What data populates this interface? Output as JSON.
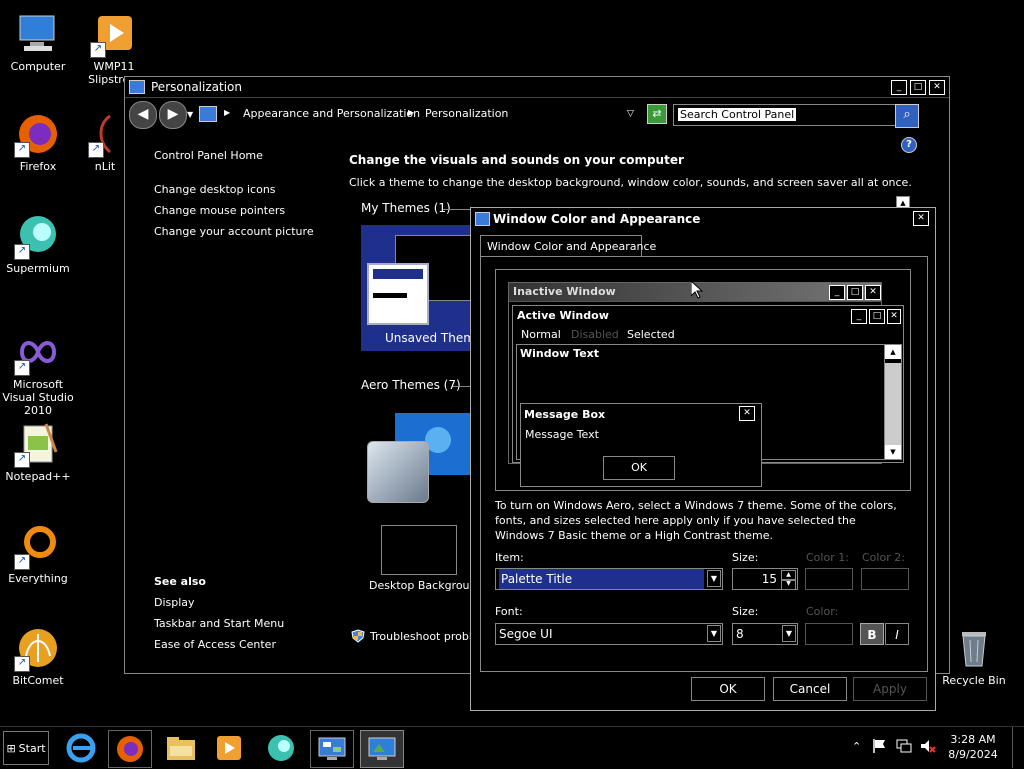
{
  "desktop": {
    "icons": [
      {
        "label": "Computer"
      },
      {
        "label": "WMP11 Slipstre..."
      },
      {
        "label": "Firefox"
      },
      {
        "label": "nLit"
      },
      {
        "label": "Supermium"
      },
      {
        "label": "Microsoft Visual Studio 2010"
      },
      {
        "label": "Notepad++"
      },
      {
        "label": "Everything"
      },
      {
        "label": "BitComet"
      },
      {
        "label": "Recycle Bin"
      }
    ]
  },
  "personalization": {
    "title": "Personalization",
    "breadcrumb": [
      "Appearance and Personalization",
      "Personalization"
    ],
    "search_placeholder": "Search Control Panel",
    "sidebar": {
      "home": "Control Panel Home",
      "links": [
        "Change desktop icons",
        "Change mouse pointers",
        "Change your account picture"
      ],
      "see_also_title": "See also",
      "see_also": [
        "Display",
        "Taskbar and Start Menu",
        "Ease of Access Center"
      ]
    },
    "heading": "Change the visuals and sounds on your computer",
    "subheading": "Click a theme to change the desktop background, window color, sounds, and screen saver all at once.",
    "my_themes": "My Themes (1)",
    "unsaved_theme": "Unsaved Theme",
    "aero_themes": "Aero Themes (7)",
    "desktop_background": "Desktop Background",
    "troubleshoot": "Troubleshoot probl"
  },
  "dialog": {
    "title": "Window Color and Appearance",
    "tab": "Window Color and Appearance",
    "preview": {
      "inactive": "Inactive Window",
      "active": "Active Window",
      "menu": [
        "Normal",
        "Disabled",
        "Selected"
      ],
      "window_text": "Window Text",
      "msgbox_title": "Message Box",
      "msgbox_text": "Message Text",
      "msgbox_ok": "OK"
    },
    "info": "To turn on Windows Aero, select a Windows 7 theme.  Some of the colors, fonts, and sizes selected here apply only if you have selected the Windows 7 Basic theme or a High Contrast theme.",
    "item_label": "Item:",
    "item_value": "Palette Title",
    "size_label": "Size:",
    "size_value": "15",
    "color1_label": "Color 1:",
    "color2_label": "Color 2:",
    "font_label": "Font:",
    "font_value": "Segoe UI",
    "font_size_label": "Size:",
    "font_size_value": "8",
    "color_label": "Color:",
    "bold": "B",
    "italic": "I",
    "ok": "OK",
    "cancel": "Cancel",
    "apply": "Apply"
  },
  "taskbar": {
    "start": "Start",
    "time": "3:28 AM",
    "date": "8/9/2024"
  },
  "colors": {
    "selection": "#1e2f8c",
    "start_button_border": "#777"
  }
}
